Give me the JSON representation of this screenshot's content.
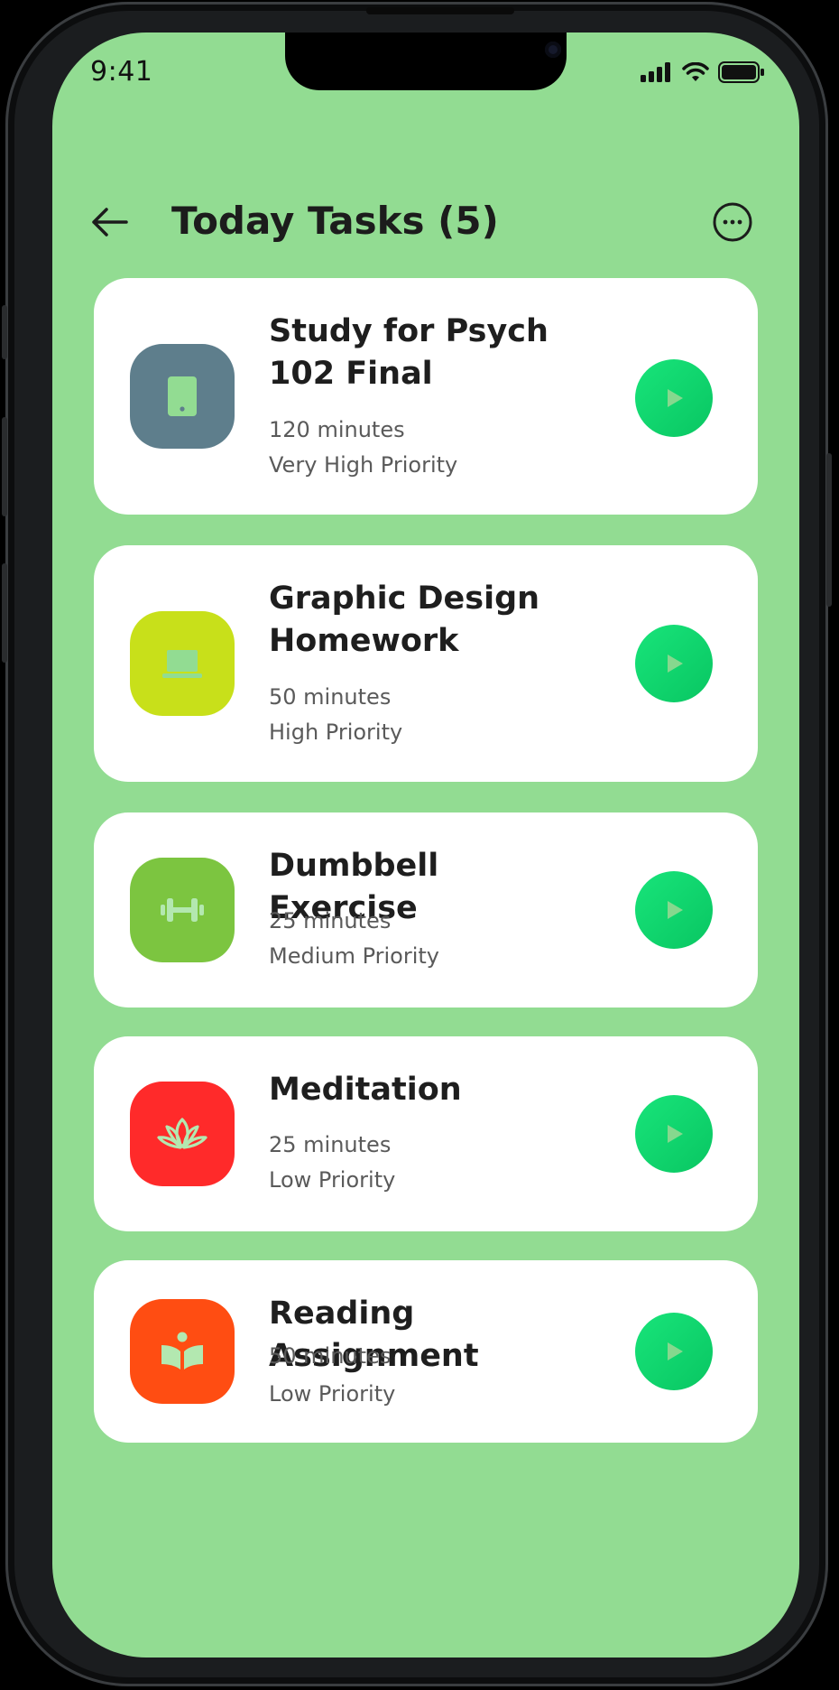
{
  "status_bar": {
    "time": "9:41"
  },
  "header": {
    "title": "Today Tasks (5)",
    "back_icon": "arrow-left-icon",
    "more_icon": "more-horizontal-icon"
  },
  "colors": {
    "background": "#92dc92",
    "card": "#ffffff",
    "play": "#0fd56e"
  },
  "tasks": [
    {
      "title": "Study for Psych 102 Final",
      "duration": "120 minutes",
      "priority": "Very High Priority",
      "icon": "tablet-icon",
      "icon_color": "#5e7e8c"
    },
    {
      "title": "Graphic Design Homework",
      "duration": "50 minutes",
      "priority": "High Priority",
      "icon": "laptop-icon",
      "icon_color": "#c8e01a"
    },
    {
      "title": "Dumbbell Exercise",
      "duration": "25 minutes",
      "priority": "Medium Priority",
      "icon": "dumbbell-icon",
      "icon_color": "#7cc540"
    },
    {
      "title": "Meditation",
      "duration": "25 minutes",
      "priority": "Low Priority",
      "icon": "lotus-icon",
      "icon_color": "#ff2a2a"
    },
    {
      "title": "Reading Assignment",
      "duration": "50 minutes",
      "priority": "Low Priority",
      "icon": "open-book-icon",
      "icon_color": "#ff4d12"
    }
  ]
}
